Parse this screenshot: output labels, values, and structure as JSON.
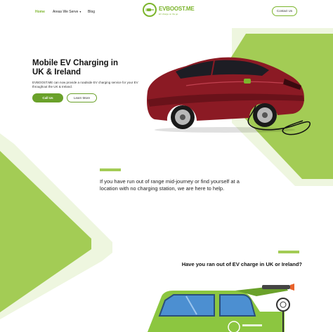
{
  "nav": {
    "home": "Home",
    "areas": "Areas We Serve",
    "blog": "Blog",
    "contact": "Contact Us"
  },
  "logo": {
    "name": "EVBOOST.ME",
    "tagline": "EV charge on the go"
  },
  "hero": {
    "title": "Mobile EV Charging in UK & Ireland",
    "description": "EVBOOST.ME can now provide a roadside EV charging service for your EV throughout the UK & Ireland.",
    "call_label": "Call Us",
    "learn_label": "Learn More"
  },
  "intro": {
    "text": "If you have run out of range mid-journey or find yourself at a location with no charging station, we are here to help."
  },
  "section2": {
    "title": "Have you ran out of EV charge in UK or Ireland?"
  },
  "colors": {
    "brand_green": "#7cb52d",
    "light_green": "#a3cc55",
    "pale_green": "#eef6df",
    "car_red": "#8b1a24"
  }
}
